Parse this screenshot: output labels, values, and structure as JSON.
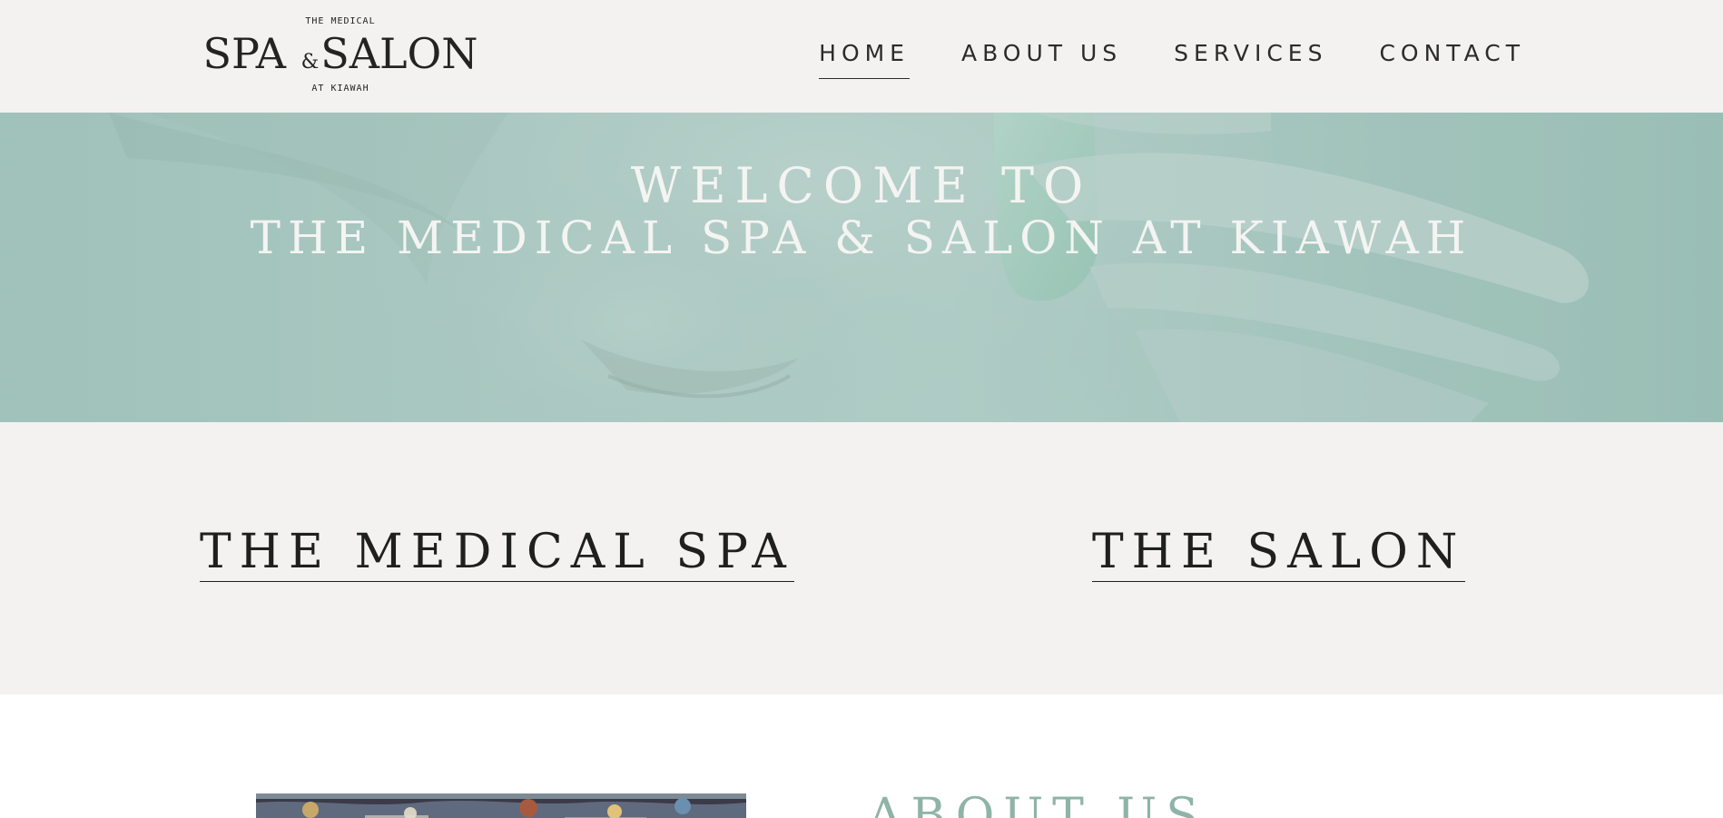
{
  "header": {
    "logo": {
      "top_text": "THE MEDICAL",
      "main_left": "SPA",
      "main_amp": "&",
      "main_right": "SALON",
      "bottom_text": "AT KIAWAH"
    },
    "nav": [
      {
        "label": "HOME",
        "active": true
      },
      {
        "label": "ABOUT US",
        "active": false
      },
      {
        "label": "SERVICES",
        "active": false
      },
      {
        "label": "CONTACT",
        "active": false
      }
    ]
  },
  "hero": {
    "line1": "WELCOME TO",
    "line2": "THE MEDICAL SPA & SALON AT KIAWAH"
  },
  "split": {
    "left_label": "THE MEDICAL SPA",
    "right_label": "THE SALON"
  },
  "about": {
    "heading": "ABOUT US"
  },
  "colors": {
    "header_bg": "#f3f2f0",
    "hero_tint": "#a8c8c0",
    "accent_green": "#8fb3a8",
    "text_dark": "#1f1f1f"
  }
}
